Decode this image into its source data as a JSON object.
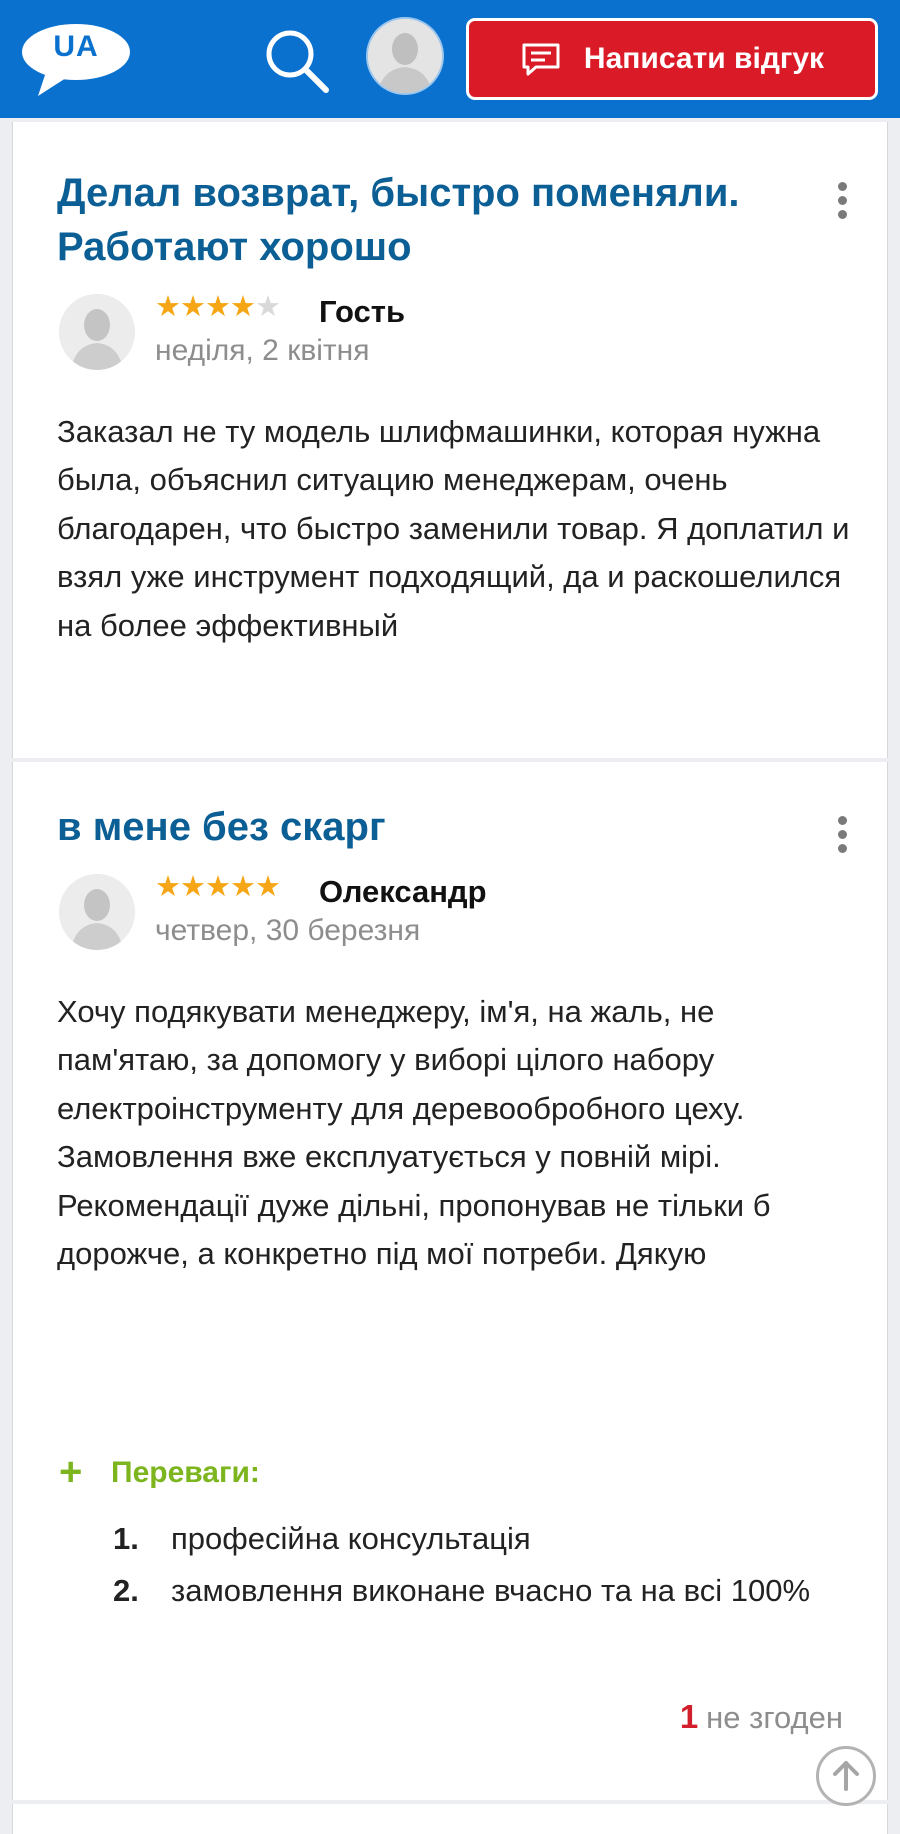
{
  "header": {
    "logo_text": "UA",
    "write_review_label": "Написати відгук",
    "icons": {
      "search": "search-icon",
      "avatar": "user-avatar-icon",
      "write": "comment-icon"
    },
    "colors": {
      "bar": "#0a71cf",
      "button": "#da1b27"
    }
  },
  "reviews": [
    {
      "title": "Делал возврат, быстро поменяли. Работают хорошо",
      "rating": 4,
      "rating_max": 5,
      "author": "Гость",
      "date": "неділя, 2 квітня",
      "text": "Заказал не ту модель шлифмашинки, которая нужна была, объяснил ситуацию менеджерам, очень благодарен, что быстро заменили товар. Я доплатил и взял уже инструмент подходящий, да и раскошелился на более эффективный"
    },
    {
      "title": "в мене без скарг",
      "rating": 5,
      "rating_max": 5,
      "author": "Олександр",
      "date": "четвер, 30 березня",
      "text": "Хочу подякувати менеджеру, ім'я, на жаль, не пам'ятаю, за допомогу у виборі цілого набору електроінструменту для деревообробного цеху.\nЗамовлення вже експлуатується у повній мірі.\nРекомендації дуже дільні, пропонував не тільки б дорожче, а конкретно під мої потреби. Дякую",
      "pros_label": "Переваги:",
      "pros": [
        {
          "num": "1.",
          "text": "професійна консультація"
        },
        {
          "num": "2.",
          "text": "замовлення виконане вчасно та на всі 100%"
        }
      ],
      "disagree_count": "1",
      "disagree_label": "не згоден"
    }
  ]
}
